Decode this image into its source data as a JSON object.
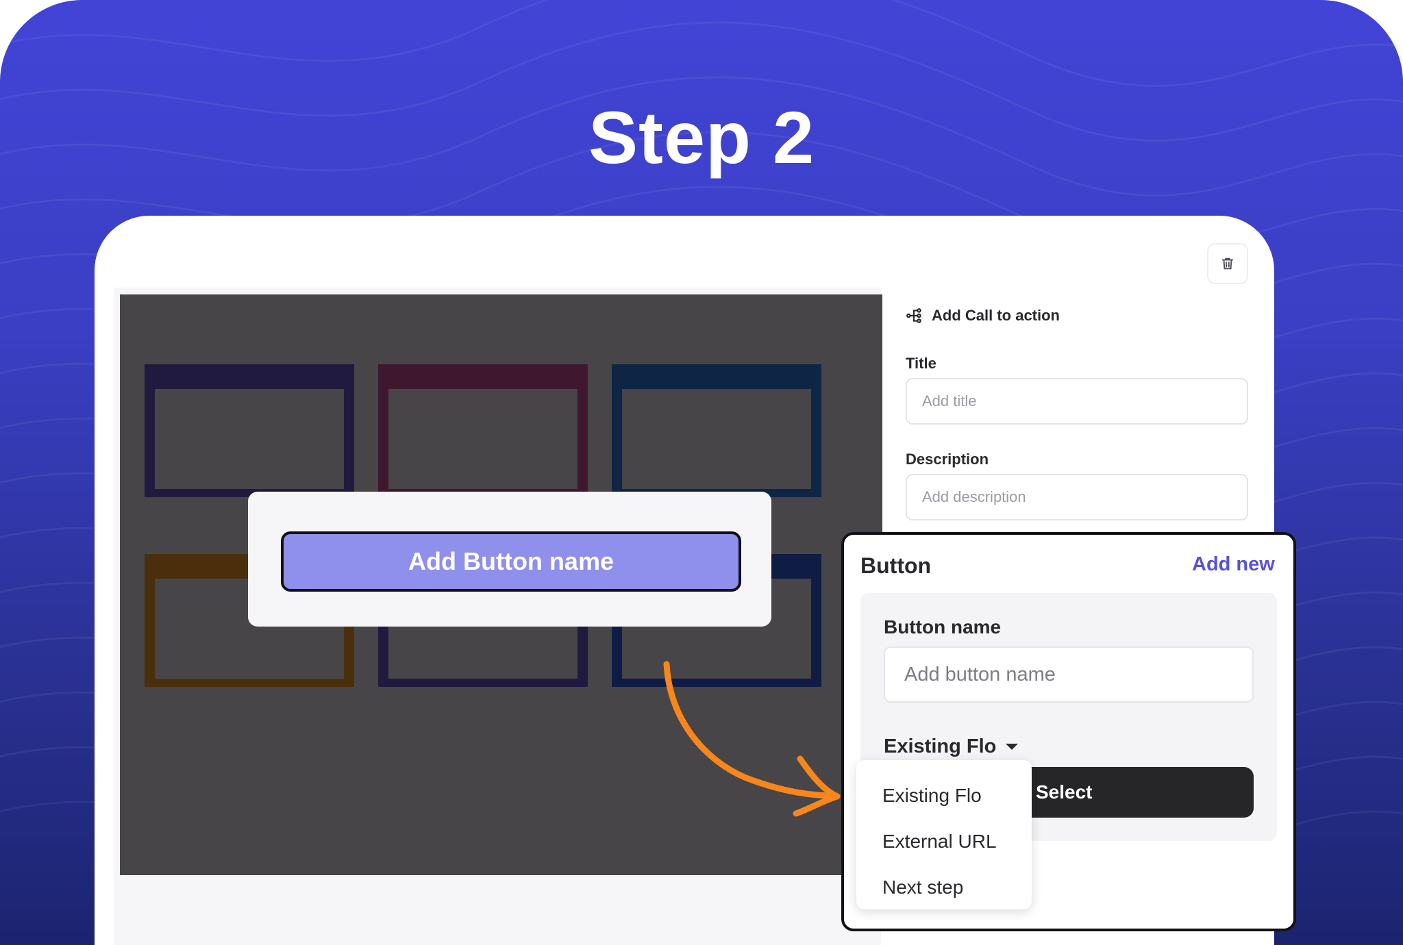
{
  "step": {
    "title": "Step 2"
  },
  "canvas": {
    "tile_colors": [
      "#211a3f",
      "#3f1830",
      "#0e2545",
      "#4a2f0d",
      "#211a3f",
      "#0f1c45"
    ]
  },
  "panel": {
    "cta_label": "Add Call to action",
    "title_label": "Title",
    "title_placeholder": "Add title",
    "description_label": "Description",
    "description_placeholder": "Add description"
  },
  "popup": {
    "button_label": "Add Button name"
  },
  "button_card": {
    "title": "Button",
    "add_new": "Add new",
    "name_label": "Button name",
    "name_placeholder": "Add button name",
    "flo_selected": "Existing Flo",
    "select_label": "Select",
    "options": [
      "Existing Flo",
      "External URL",
      "Next step"
    ]
  },
  "colors": {
    "accent_purple": "#8f8fec",
    "link_purple": "#5653d6",
    "arrow_orange": "#f7861c",
    "background_blue": "#3a3fc4"
  },
  "icons": {
    "cta": "flow-branch-icon",
    "delete": "trash-icon",
    "caret": "caret-down-icon"
  }
}
